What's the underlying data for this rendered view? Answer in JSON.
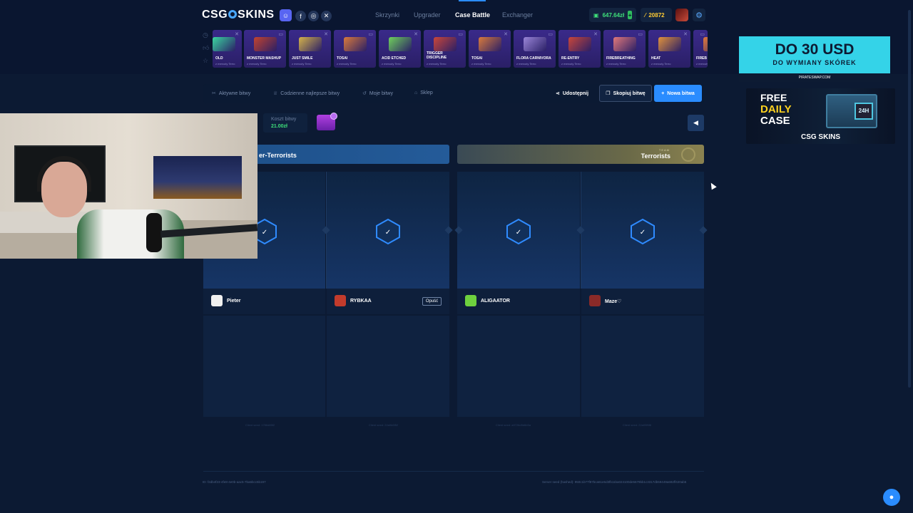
{
  "header": {
    "logo": "CSG",
    "logo_suffix": "SKINS",
    "nav": [
      "Skrzynki",
      "Upgrader",
      "Case Battle",
      "Exchanger"
    ],
    "active_nav": "Case Battle",
    "balance": "647.64zł",
    "points": "20872",
    "accent": "#2a8cff"
  },
  "drops": [
    {
      "name": "OLD",
      "sub": "z mercuty Terro",
      "color": "#3bd6a0"
    },
    {
      "name": "MONSTER MASHUP",
      "sub": "z mercuty Terro",
      "color": "#c2432f"
    },
    {
      "name": "JUST SMILE",
      "sub": "z mercuty Terro",
      "color": "#d4b24a"
    },
    {
      "name": "TOSAI",
      "sub": "z mercuty Terro",
      "color": "#d87a3c"
    },
    {
      "name": "ACID ETCHED",
      "sub": "z mercuty Terro",
      "color": "#6fd05c"
    },
    {
      "name": "TRIGGER DISCIPLINE",
      "sub": "z mercuty Terro",
      "color": "#c9463a"
    },
    {
      "name": "TOSAI",
      "sub": "z mercuty Terro",
      "color": "#d87a3c"
    },
    {
      "name": "FLORA CARNIVORA",
      "sub": "z mercuty Terro",
      "color": "#9a86d8"
    },
    {
      "name": "RE-ENTRY",
      "sub": "z mercuty Terro",
      "color": "#c8463a"
    },
    {
      "name": "FIREBREATHING",
      "sub": "z mercuty Terro",
      "color": "#e0787a"
    },
    {
      "name": "HEAT",
      "sub": "z mercuty Terro",
      "color": "#e0923c"
    },
    {
      "name": "FIREB",
      "sub": "z mercuty Terro",
      "color": "#e07a3c"
    }
  ],
  "ads": {
    "ad1_line1": "DO 30 USD",
    "ad1_line2": "DO WYMIANY SKÓREK",
    "ad1_url": "PIRATESWAP.COM",
    "ad2_free": "FREE",
    "ad2_daily": "DAILY",
    "ad2_case": "CASE",
    "ad2_box": "24H",
    "ad2_brand": "CSG SKINS"
  },
  "tabs": {
    "active": "Aktywne bitwy",
    "daily": "Codzienne najlepsze bitwy",
    "mine": "Moje bitwy",
    "shop": "Sklep",
    "share": "Udostępnij",
    "copy": "Skopiuj bitwę",
    "new": "Nowa bitwa"
  },
  "battle": {
    "cost_label": "Koszt bitwy",
    "cost_value": "21.00zł",
    "team_ct": "er-Terrorists",
    "team_t_tag": "TEAM",
    "team_t": "Terrorists"
  },
  "players": [
    {
      "name": "Pieter",
      "color": "#e8e8e8"
    },
    {
      "name": "RYBKAA",
      "color": "#c23b2c",
      "leave": "Opuść"
    },
    {
      "name": "ALIGAATOR",
      "color": "#6ed13e"
    },
    {
      "name": "Maze♡",
      "color": "#8a2a28"
    }
  ],
  "seeds": [
    "Client seed: 1786d85f2",
    "Client seed: 22a0b6f52",
    "Client seed: a9726d9d6b5a",
    "Client seed: 22a09f6f8"
  ],
  "footer": {
    "id": "ID: f2db4f23-4fe8-4e0b-aac5-7ba6bcc5b197",
    "server_seed": "Server seed (hashed): 950c1b77f87bca61e6d3fb11ba024100de5679bb1c3317db59449a692ff420ab5"
  }
}
